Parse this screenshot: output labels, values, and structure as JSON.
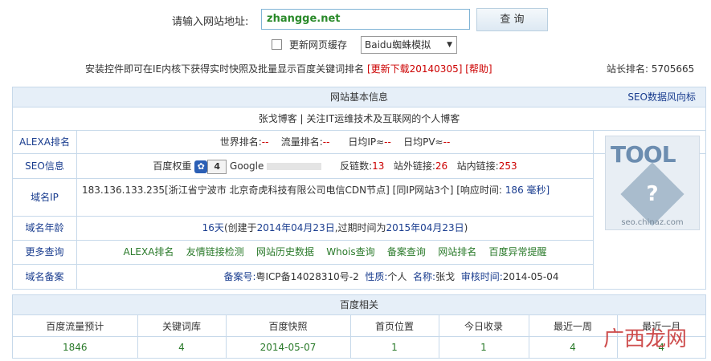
{
  "search": {
    "label": "请输入网站地址:",
    "value": "zhangge.net",
    "button": "查 询"
  },
  "options": {
    "refresh_label": "更新网页缓存",
    "mode_selected": "Baidu蜘蛛模拟"
  },
  "notice": {
    "text": "安装控件即可在IE内核下获得实时快照及批量显示百度关键词排名",
    "download_link": "[更新下载20140305]",
    "help_link": "[帮助]",
    "site_rank": "站长排名: 5705665"
  },
  "basic_info": {
    "title": "网站基本信息",
    "seo_link": "SEO数据风向标",
    "site_title": "张戈博客 | 关注IT运维技术及互联网的个人博客",
    "alexa": {
      "label": "ALEXA排名",
      "world_rank_label": "世界排名:",
      "world_rank": "--",
      "traffic_rank_label": "流量排名:",
      "traffic_rank": "--",
      "daily_ip_label": "日均IP≈",
      "daily_ip": "--",
      "daily_pv_label": "日均PV≈",
      "daily_pv": "--"
    },
    "seo": {
      "label": "SEO信息",
      "baidu_weight_label": "百度权重",
      "baidu_weight": "4",
      "google_label": "Google",
      "backlinks_label": "反链数:",
      "backlinks": "13",
      "external_links_label": "站外链接:",
      "external_links": "26",
      "internal_links_label": "站内链接:",
      "internal_links": "253"
    },
    "ip": {
      "label": "域名IP",
      "text": "183.136.133.235[浙江省宁波市 北京奇虎科技有限公司电信CDN节点]  [同IP网站3个]  [响应时间:",
      "response_time": "186",
      "unit": "毫秒]"
    },
    "age": {
      "label": "域名年龄",
      "days": "16天",
      "created_label": "(创建于",
      "created": "2014年04月23日",
      "expire_label": ",过期时间为",
      "expire": "2015年04月23日",
      "close": ")"
    },
    "more": {
      "label": "更多查询",
      "links": [
        "ALEXA排名",
        "友情链接检测",
        "网站历史数据",
        "Whois查询",
        "备案查询",
        "网站排名",
        "百度异常提醒"
      ]
    },
    "icp": {
      "label": "域名备案",
      "icp_label": "备案号:",
      "icp": "粤ICP备14028310号-2",
      "nature_label": "性质:",
      "nature": "个人",
      "name_label": "名称:",
      "name": "张戈",
      "date_label": "审核时间:",
      "date": "2014-05-04"
    },
    "tool_image": {
      "title": "TOOL",
      "question": "?",
      "url": "seo.chinaz.com"
    }
  },
  "baidu": {
    "title": "百度相关",
    "headers": [
      "百度流量预计",
      "关键词库",
      "百度快照",
      "首页位置",
      "今日收录",
      "最近一周",
      "最近一月"
    ],
    "values": [
      "1846",
      "4",
      "2014-05-07",
      "1",
      "1",
      "4",
      "4"
    ]
  },
  "watermark": "广西龙网"
}
